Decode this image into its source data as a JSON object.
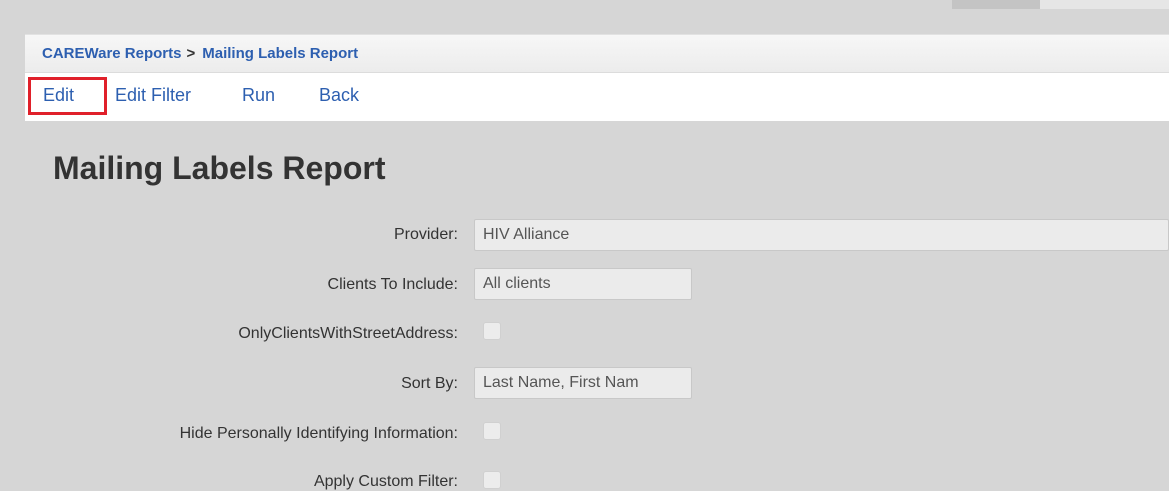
{
  "breadcrumb": {
    "root": "CAREWare Reports",
    "separator": ">",
    "current": "Mailing Labels Report"
  },
  "actions": {
    "edit": "Edit",
    "edit_filter": "Edit Filter",
    "run": "Run",
    "back": "Back"
  },
  "page_title": "Mailing Labels Report",
  "form": {
    "provider": {
      "label": "Provider:",
      "value": "HIV Alliance"
    },
    "clients_to_include": {
      "label": "Clients To Include:",
      "value": "All clients"
    },
    "only_street_address": {
      "label": "OnlyClientsWithStreetAddress:",
      "checked": false
    },
    "sort_by": {
      "label": "Sort By:",
      "value": "Last Name, First Nam"
    },
    "hide_pii": {
      "label": "Hide Personally Identifying Information:",
      "checked": false
    },
    "apply_custom_filter": {
      "label": "Apply Custom Filter:",
      "checked": false
    }
  },
  "colors": {
    "link": "#2d5fb0",
    "highlight": "#e0202a",
    "background": "#d6d6d6"
  }
}
